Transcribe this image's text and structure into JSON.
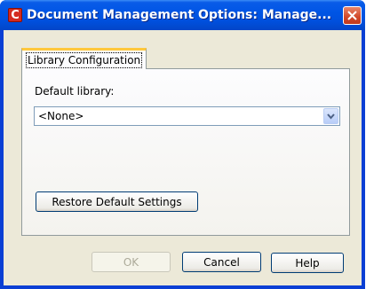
{
  "window": {
    "title": "Document Management Options:  Manage...",
    "app_icon": "C",
    "close_icon": "close-icon"
  },
  "tabs": [
    {
      "label": "Library Configuration",
      "active": true
    }
  ],
  "library": {
    "label": "Default library:",
    "selected": "<None>"
  },
  "buttons": {
    "restore": "Restore Default Settings",
    "ok": "OK",
    "cancel": "Cancel",
    "help": "Help"
  },
  "colors": {
    "titlebar": "#0055e5",
    "tab_highlight": "#ffc83c",
    "close_button": "#d1482a",
    "dialog_background": "#ece9d8"
  }
}
